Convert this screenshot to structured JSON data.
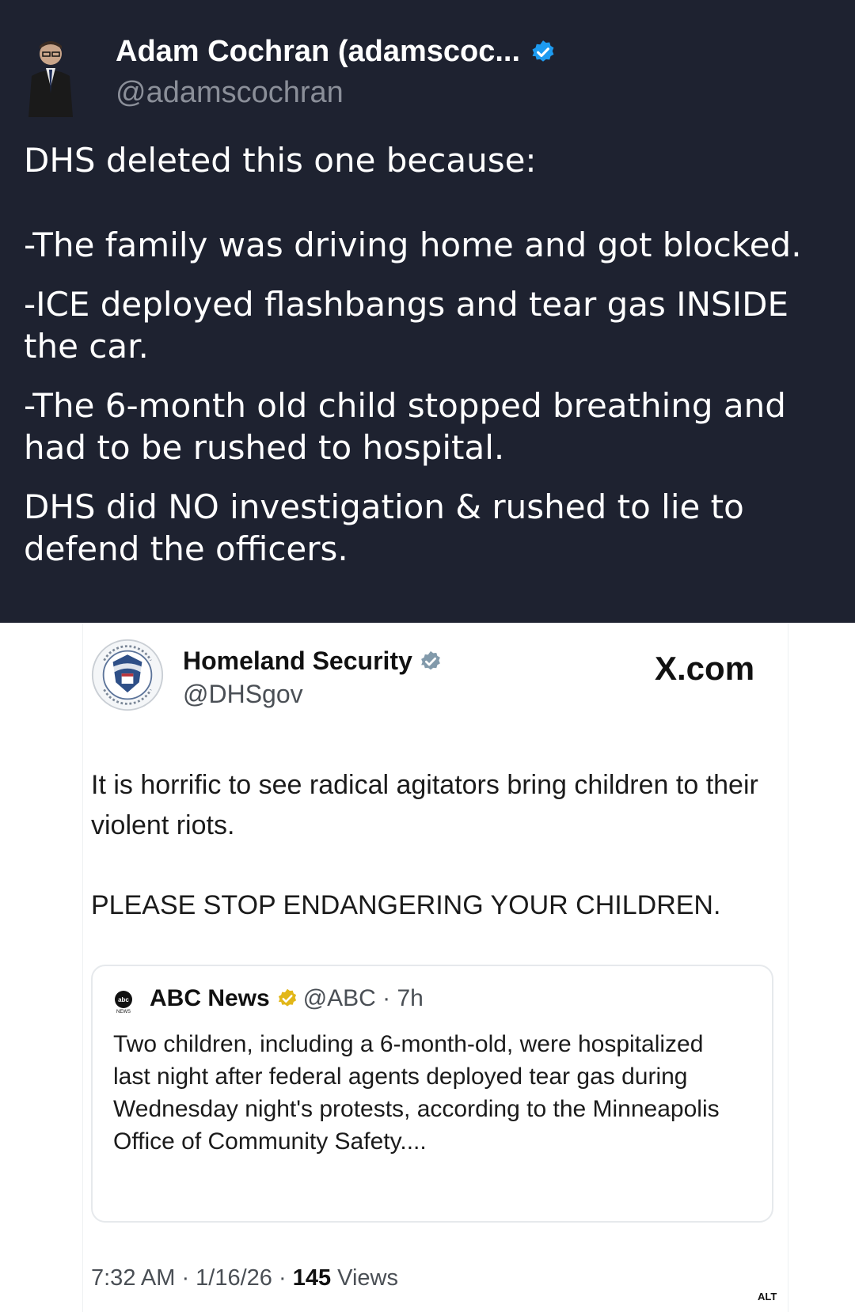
{
  "top_post": {
    "author_name": "Adam Cochran (adamscoc...",
    "author_handle": "@adamscochran",
    "lines": [
      "DHS deleted this one because:",
      "-The family was driving home and got blocked.",
      "-ICE deployed flashbangs and tear gas INSIDE the car.",
      "-The 6-month old child stopped breathing and had to be rushed to hospital.",
      "DHS did NO investigation & rushed to lie to defend the officers."
    ]
  },
  "embedded": {
    "name": "Homeland Security",
    "handle": "@DHSgov",
    "site": "X.com",
    "seal_text": "DEPARTMENT OF HOMELAND SECURITY U.S.",
    "body": "It is horrific to see radical agitators bring children to their violent riots.",
    "caps": "PLEASE STOP ENDANGERING YOUR CHILDREN.",
    "quote": {
      "name": "ABC News",
      "meta": "@ABC · 7h",
      "text": "Two children, including a 6-month-old, were hospitalized last night after federal agents deployed tear gas during Wednesday night's protests, according to the Minneapolis Office of Community Safety...."
    },
    "time": "7:32 AM · 1/16/26 · ",
    "views_count": "145",
    "views_label": " Views",
    "alt": "ALT"
  },
  "colors": {
    "top_bg": "#1e2230",
    "verified_blue": "#1d9bf0",
    "gov_gray": "#829aab",
    "gold": "#e2b719"
  },
  "icons": {
    "verified": "verified-check-icon",
    "gov_verified": "gov-verified-icon",
    "abc_verified": "gold-verified-icon"
  }
}
